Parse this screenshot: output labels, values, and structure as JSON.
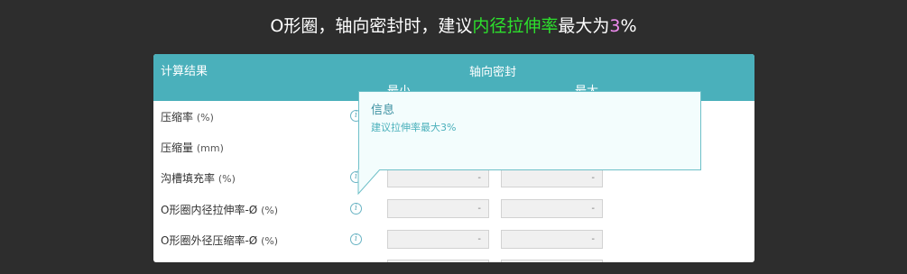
{
  "headline": {
    "prefix": "O形圈，轴向密封时，建议",
    "highlight": "内径拉伸率",
    "middle": "最大为",
    "value": "3",
    "suffix": "%"
  },
  "table": {
    "header_title": "计算结果",
    "group_label": "轴向密封",
    "col_min": "最小",
    "col_max": "最大",
    "rows": [
      {
        "label": "压缩率",
        "unit": "(%)",
        "min": "",
        "max": ""
      },
      {
        "label": "压缩量",
        "unit": "(mm)",
        "min": "",
        "max": ""
      },
      {
        "label": "沟槽填充率",
        "unit": "(%)",
        "min": "-",
        "max": "-"
      },
      {
        "label": "O形圈内径拉伸率-Ø",
        "unit": "(%)",
        "min": "-",
        "max": "-"
      },
      {
        "label": "O形圈外径压缩率-Ø",
        "unit": "(%)",
        "min": "-",
        "max": "-"
      }
    ]
  },
  "tooltip": {
    "title": "信息",
    "body": "建议拉伸率最大3%"
  },
  "icons": {
    "info": "info-icon",
    "info_glyph": "i"
  },
  "colors": {
    "header": "#4ab0bb",
    "highlight_green": "#2de02d",
    "highlight_pink": "#f08cf0"
  }
}
